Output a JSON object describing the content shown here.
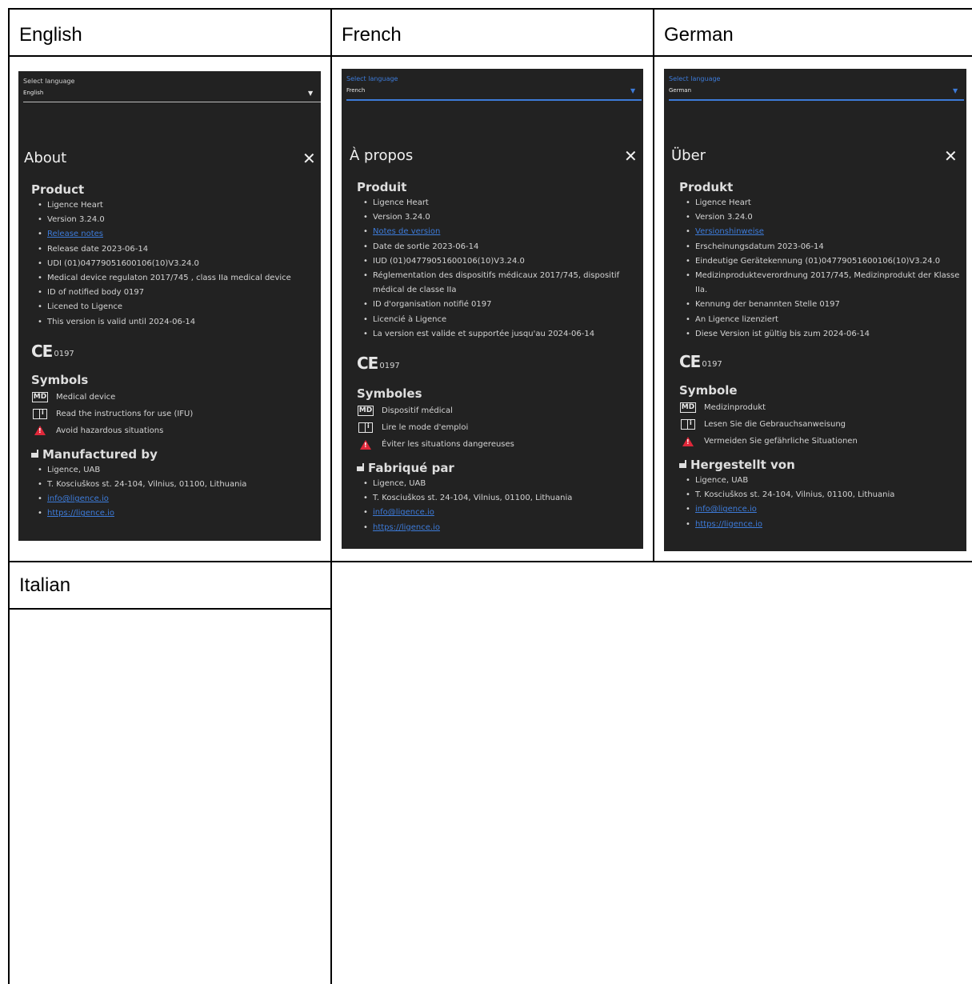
{
  "table": {
    "headers": [
      "English",
      "French",
      "German",
      "Italian"
    ]
  },
  "panels": {
    "en": {
      "select_label": "Select language",
      "select_value": "English",
      "title": "About",
      "close": "✕",
      "product_title": "Product",
      "product_items": [
        "Ligence Heart",
        "Version 3.24.0",
        "Release notes",
        "Release date 2023-06-14",
        "UDI (01)04779051600106(10)V3.24.0",
        "Medical device regulaton 2017/745 , class IIa medical device",
        "ID of notified body 0197",
        "Licened to Ligence",
        "This version is valid until 2024-06-14"
      ],
      "ce_mark": "CE",
      "ce_number": "0197",
      "symbols_title": "Symbols",
      "symbols": [
        "Medical device",
        "Read the instructions for use (IFU)",
        "Avoid hazardous situations"
      ],
      "md_label": "MD",
      "mfg_title": "Manufactured by",
      "mfg_items": [
        "Ligence, UAB",
        "T. Kosciuškos st. 24-104, Vilnius, 01100, Lithuania",
        "info@ligence.io",
        "https://ligence.io"
      ]
    },
    "fr": {
      "select_label": "Select language",
      "select_value": "French",
      "title": "À propos",
      "close": "✕",
      "product_title": "Produit",
      "product_items": [
        "Ligence Heart",
        "Version 3.24.0",
        "Notes de version",
        "Date de sortie 2023-06-14",
        "IUD (01)04779051600106(10)V3.24.0",
        "Réglementation des dispositifs médicaux 2017/745, dispositif médical de classe IIa",
        "ID d'organisation notifié 0197",
        "Licencié à Ligence",
        "La version est valide et supportée jusqu'au 2024-06-14"
      ],
      "ce_mark": "CE",
      "ce_number": "0197",
      "symbols_title": "Symboles",
      "symbols": [
        "Dispositif médical",
        "Lire le mode d'emploi",
        "Éviter les situations dangereuses"
      ],
      "md_label": "MD",
      "mfg_title": "Fabriqué par",
      "mfg_items": [
        "Ligence, UAB",
        "T. Kosciuškos st. 24-104, Vilnius, 01100, Lithuania",
        "info@ligence.io",
        "https://ligence.io"
      ]
    },
    "de": {
      "select_label": "Select language",
      "select_value": "German",
      "title": "Über",
      "close": "✕",
      "product_title": "Produkt",
      "product_items": [
        "Ligence Heart",
        "Version 3.24.0",
        "Versionshinweise",
        "Erscheinungsdatum 2023-06-14",
        "Eindeutige Gerätekennung (01)04779051600106(10)V3.24.0",
        "Medizinprodukteverordnung 2017/745, Medizinprodukt der Klasse IIa.",
        "Kennung der benannten Stelle 0197",
        "An Ligence lizenziert",
        "Diese Version ist gültig bis zum 2024-06-14"
      ],
      "ce_mark": "CE",
      "ce_number": "0197",
      "symbols_title": "Symbole",
      "symbols": [
        "Medizinprodukt",
        "Lesen Sie die Gebrauchsanweisung",
        "Vermeiden Sie gefährliche Situationen"
      ],
      "md_label": "MD",
      "mfg_title": "Hergestellt von",
      "mfg_items": [
        "Ligence, UAB",
        "T. Kosciuškos st. 24-104, Vilnius, 01100, Lithuania",
        "info@ligence.io",
        "https://ligence.io"
      ]
    }
  },
  "colors": {
    "panel_bg": "#222222",
    "link": "#3d7bd9",
    "focus_accent": "#3d7bd9",
    "warning": "#e0283a"
  },
  "icons": {
    "md": "medical-device-icon",
    "ifu": "instructions-book-icon",
    "warning": "warning-triangle-icon",
    "factory": "factory-icon",
    "dropdown": "dropdown-arrow-icon",
    "close": "close-icon"
  }
}
